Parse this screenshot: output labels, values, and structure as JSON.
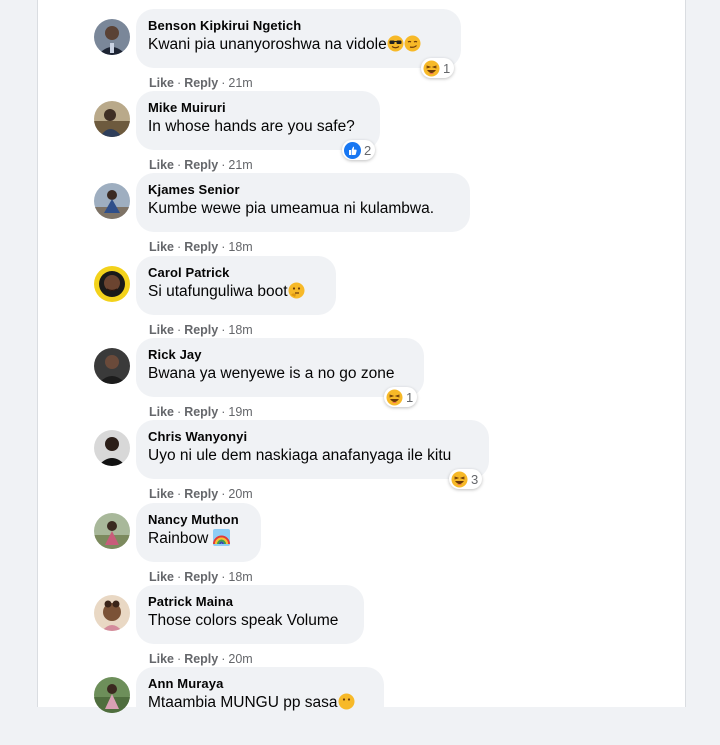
{
  "actions": {
    "like": "Like",
    "reply": "Reply",
    "sep": "·"
  },
  "comments": [
    {
      "name": "Benson Kipkirui Ngetich",
      "text": "Kwani pia unanyoroshwa na vidole",
      "time": "21m",
      "reaction": {
        "icon": "haha-icon",
        "count": "1"
      }
    },
    {
      "name": "Mike Muiruri",
      "text": "In whose hands are you safe?",
      "time": "21m",
      "reaction": {
        "icon": "like-icon",
        "count": "2"
      }
    },
    {
      "name": "Kjames Senior",
      "text": "Kumbe wewe pia umeamua ni kulambwa.",
      "time": "18m"
    },
    {
      "name": "Carol Patrick",
      "text": "Si utafunguliwa boot",
      "time": "18m"
    },
    {
      "name": "Rick Jay",
      "text": "Bwana ya wenyewe is a no go zone",
      "time": "19m",
      "reaction": {
        "icon": "haha-icon",
        "count": "1"
      }
    },
    {
      "name": "Chris Wanyonyi",
      "text": "Uyo ni ule dem naskiaga anafanyaga ile kitu",
      "time": "20m",
      "reaction": {
        "icon": "haha-icon",
        "count": "3"
      }
    },
    {
      "name": "Nancy Muthon",
      "text": "Rainbow",
      "time": "18m"
    },
    {
      "name": "Patrick Maina",
      "text": "Those colors speak Volume",
      "time": "20m"
    },
    {
      "name": "Ann Muraya",
      "text": "Mtaambia MUNGU pp sasa",
      "time": ""
    }
  ],
  "colors": {
    "background": "#f0f2f5",
    "bubble": "#f0f2f5",
    "like_blue": "#1877f2",
    "haha_yellow": "#f7b928"
  }
}
